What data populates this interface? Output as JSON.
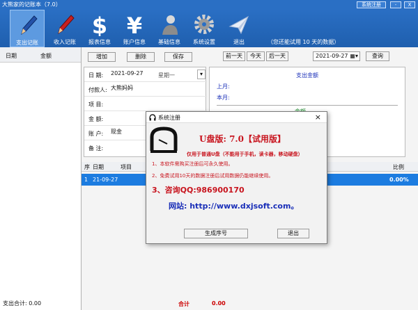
{
  "window": {
    "title": "大熊家的记账本（7.0）",
    "register_btn": "系统注册",
    "close_btn": "X",
    "min_btn": "-"
  },
  "toolbar": {
    "items": [
      {
        "label": "支出记账",
        "icon": "pencil-icon"
      },
      {
        "label": "收入记账",
        "icon": "red-pencil-icon"
      },
      {
        "label": "报表信息",
        "icon": "dollar-icon"
      },
      {
        "label": "账户信息",
        "icon": "yen-icon"
      },
      {
        "label": "基础信息",
        "icon": "user-icon"
      },
      {
        "label": "系统设置",
        "icon": "gear-icon"
      },
      {
        "label": "退出",
        "icon": "paper-plane-icon"
      }
    ],
    "trial_note": "（您还能试用 10 天的数据）"
  },
  "left_panel": {
    "col_date": "日期",
    "col_amount": "金额",
    "footer": "支出合计: 0.00"
  },
  "actions": {
    "add": "增加",
    "delete": "删除",
    "save": "保存",
    "prev_day": "前一天",
    "today": "今天",
    "next_day": "后一天",
    "query": "查询",
    "date_value": "2021-09-27"
  },
  "form": {
    "date_label": "日 期:",
    "date_value": "2021-09-27",
    "weekday": "星期一",
    "payer_label": "付款人:",
    "payer_value": "大熊妈妈",
    "item_label": "项 目:",
    "amount_label": "金 额:",
    "account_label": "账 户:",
    "account_value": "现金",
    "remark_label": "备 注:"
  },
  "summary": {
    "title": "支出金额",
    "last_month": "上月:",
    "this_month": "本月:",
    "partial": "金额"
  },
  "table": {
    "headers": [
      "序",
      "日期",
      "项目",
      "比例"
    ],
    "rows": [
      {
        "seq": "1",
        "date": "21-09-27",
        "ratio": "0.00%"
      }
    ],
    "total_label": "合计",
    "total_value": "0.00"
  },
  "dialog": {
    "title": "系统注册",
    "close": "×",
    "headline": "U盘版: 7.0【试用版】",
    "subtitle": "仅用于普通U盘（不能用于手机，读卡器，移动硬盘）",
    "note1": "1、本软件需购买注册后可永久使用。",
    "note2": "2、免费试用10天的数据注册后试用数据仍能继续使用。",
    "contact": "3、咨询QQ:986900170",
    "website": "网站: http://www.dxjsoft.com。",
    "gen_button": "生成序号",
    "exit_button": "退出",
    "colors": {
      "red": "#c8141e",
      "blue": "#1a2fb8"
    }
  }
}
